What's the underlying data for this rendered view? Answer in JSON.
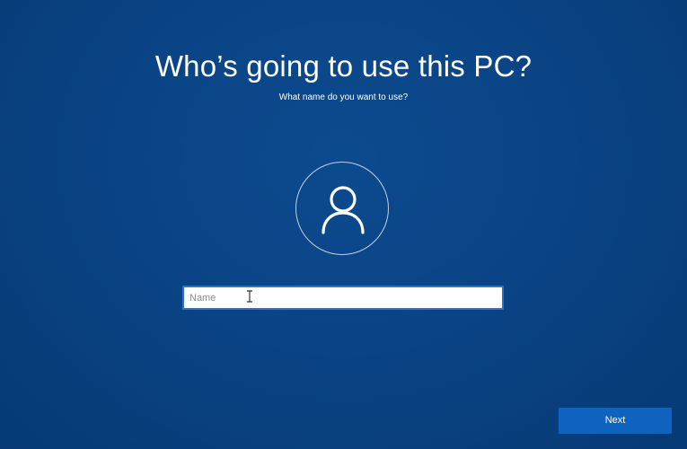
{
  "page": {
    "title": "Who’s going to use this PC?",
    "subtitle": "What name do you want to use?"
  },
  "avatar": {
    "icon": "user-icon"
  },
  "name_field": {
    "value": "",
    "placeholder": "Name"
  },
  "footer": {
    "next_label": "Next"
  },
  "colors": {
    "background": "#0a4485",
    "button": "#0e62c0",
    "input_border": "#2a73c9"
  }
}
